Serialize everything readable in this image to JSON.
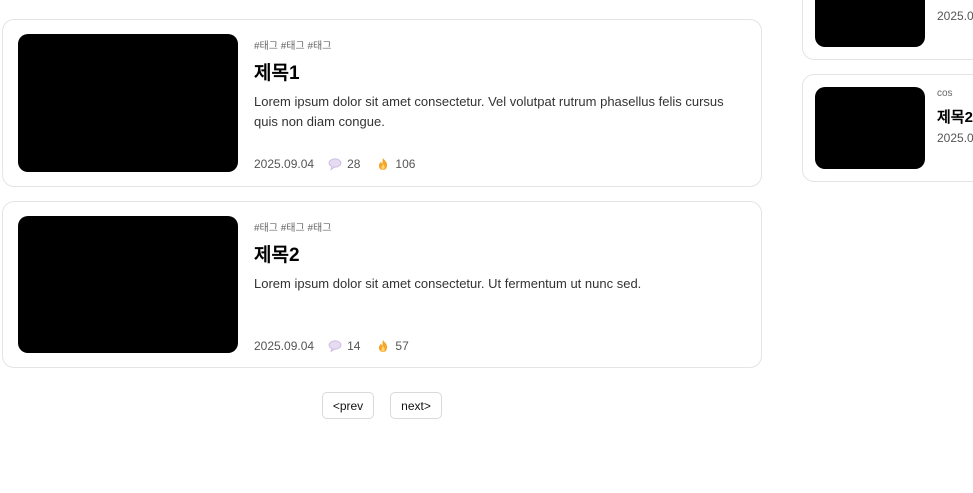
{
  "posts": [
    {
      "tags": "#태그 #태그 #태그",
      "title": "제목1",
      "excerpt": "Lorem ipsum dolor sit amet consectetur. Vel volutpat rutrum phasellus felis cursus quis non diam congue.",
      "date": "2025.09.04",
      "comments": "28",
      "likes": "106"
    },
    {
      "tags": "#태그 #태그 #태그",
      "title": "제목2",
      "excerpt": "Lorem ipsum dolor sit amet consectetur. Ut fermentum ut nunc sed.",
      "date": "2025.09.04",
      "comments": "14",
      "likes": "57"
    }
  ],
  "pagination": {
    "prev": "<prev",
    "next": "next>"
  },
  "sidebar": [
    {
      "date": "2025.0"
    },
    {
      "tag": "cos",
      "title": "제목2",
      "date": "2025.0"
    }
  ],
  "icons": {
    "comment": "speech-bubble",
    "like": "fire"
  }
}
